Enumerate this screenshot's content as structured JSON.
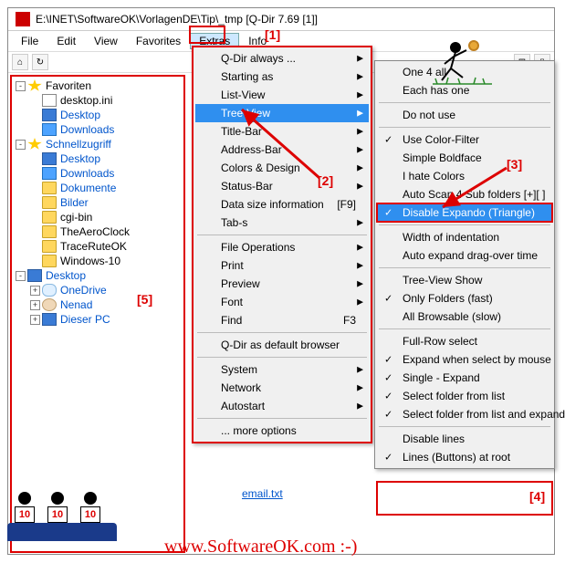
{
  "window": {
    "title": "E:\\INET\\SoftwareOK\\VorlagenDE\\Tip\\_tmp  [Q-Dir 7.69 [1]]"
  },
  "menubar": {
    "items": [
      "File",
      "Edit",
      "View",
      "Favorites",
      "Extras",
      "Info"
    ]
  },
  "annotations": {
    "a1": "[1]",
    "a2": "[2]",
    "a3": "[3]",
    "a4": "[4]",
    "a5": "[5]"
  },
  "tree": {
    "items": [
      {
        "exp": "-",
        "icon": "star",
        "label": "Favoriten",
        "indent": 0,
        "blue": false
      },
      {
        "exp": "",
        "icon": "file",
        "label": "desktop.ini",
        "indent": 1,
        "blue": false
      },
      {
        "exp": "",
        "icon": "monitor",
        "label": "Desktop",
        "indent": 1,
        "blue": true
      },
      {
        "exp": "",
        "icon": "folder-blue",
        "label": "Downloads",
        "indent": 1,
        "blue": true
      },
      {
        "exp": "-",
        "icon": "star",
        "label": "Schnellzugriff",
        "indent": 0,
        "blue": true
      },
      {
        "exp": "",
        "icon": "monitor",
        "label": "Desktop",
        "indent": 1,
        "blue": true
      },
      {
        "exp": "",
        "icon": "folder-blue",
        "label": "Downloads",
        "indent": 1,
        "blue": true
      },
      {
        "exp": "",
        "icon": "folder",
        "label": "Dokumente",
        "indent": 1,
        "blue": true
      },
      {
        "exp": "",
        "icon": "folder",
        "label": "Bilder",
        "indent": 1,
        "blue": true
      },
      {
        "exp": "",
        "icon": "folder",
        "label": "cgi-bin",
        "indent": 1,
        "blue": false
      },
      {
        "exp": "",
        "icon": "folder",
        "label": "TheAeroClock",
        "indent": 1,
        "blue": false
      },
      {
        "exp": "",
        "icon": "folder",
        "label": "TraceRuteOK",
        "indent": 1,
        "blue": false
      },
      {
        "exp": "",
        "icon": "folder",
        "label": "Windows-10",
        "indent": 1,
        "blue": false
      },
      {
        "exp": "-",
        "icon": "monitor",
        "label": "Desktop",
        "indent": 0,
        "blue": true
      },
      {
        "exp": "+",
        "icon": "cloud",
        "label": "OneDrive",
        "indent": 1,
        "blue": true
      },
      {
        "exp": "+",
        "icon": "user",
        "label": "Nenad",
        "indent": 1,
        "blue": true
      },
      {
        "exp": "+",
        "icon": "monitor",
        "label": "Dieser PC",
        "indent": 1,
        "blue": true
      }
    ]
  },
  "extras_menu": {
    "items": [
      {
        "label": "Q-Dir always ...",
        "arrow": true
      },
      {
        "label": "Starting as",
        "arrow": true
      },
      {
        "label": "List-View",
        "arrow": true
      },
      {
        "label": "Tree-View",
        "arrow": true,
        "highlighted": true
      },
      {
        "label": "Title-Bar",
        "arrow": true
      },
      {
        "label": "Address-Bar",
        "arrow": true
      },
      {
        "label": "Colors & Design",
        "arrow": true
      },
      {
        "label": "Status-Bar",
        "arrow": true
      },
      {
        "label": "Data size information",
        "shortcut": "[F9]"
      },
      {
        "label": "Tab-s",
        "arrow": true
      },
      {
        "sep": true
      },
      {
        "label": "File Operations",
        "arrow": true
      },
      {
        "label": "Print",
        "arrow": true
      },
      {
        "label": "Preview",
        "arrow": true
      },
      {
        "label": "Font",
        "arrow": true
      },
      {
        "label": "Find",
        "shortcut": "F3"
      },
      {
        "sep": true
      },
      {
        "label": "Q-Dir as default browser"
      },
      {
        "sep": true
      },
      {
        "label": "System",
        "arrow": true
      },
      {
        "label": "Network",
        "arrow": true
      },
      {
        "label": "Autostart",
        "arrow": true
      },
      {
        "sep": true
      },
      {
        "label": "... more options"
      }
    ]
  },
  "treeview_menu": {
    "items": [
      {
        "label": "One 4 all"
      },
      {
        "label": "Each has one"
      },
      {
        "sep": true
      },
      {
        "label": "Do not use"
      },
      {
        "sep": true
      },
      {
        "label": "Use Color-Filter",
        "check": true
      },
      {
        "label": "Simple Boldface"
      },
      {
        "label": "I hate Colors"
      },
      {
        "label": "Auto Scan 4 Sub folders  [+][ ]"
      },
      {
        "label": "Disable Expando (Triangle)",
        "check": true,
        "highlighted": true,
        "boxed": true
      },
      {
        "sep": true
      },
      {
        "label": "Width of indentation"
      },
      {
        "label": "Auto expand drag-over time"
      },
      {
        "sep": true
      },
      {
        "label": "Tree-View Show"
      },
      {
        "label": "Only Folders (fast)",
        "check": true
      },
      {
        "label": "All Browsable (slow)"
      },
      {
        "sep": true
      },
      {
        "label": "Full-Row select"
      },
      {
        "label": "Expand when select by mouse",
        "check": true
      },
      {
        "label": "Single - Expand",
        "check": true
      },
      {
        "label": "Select folder from list",
        "check": true
      },
      {
        "label": "Select folder from list and expand",
        "check": true
      },
      {
        "sep": true
      },
      {
        "label": "Disable lines"
      },
      {
        "label": "Lines (Buttons) at root",
        "check": true
      }
    ]
  },
  "watermark": "www.SoftwareOK.com :-)",
  "judge_score": "10",
  "bottom_file": "email.txt"
}
